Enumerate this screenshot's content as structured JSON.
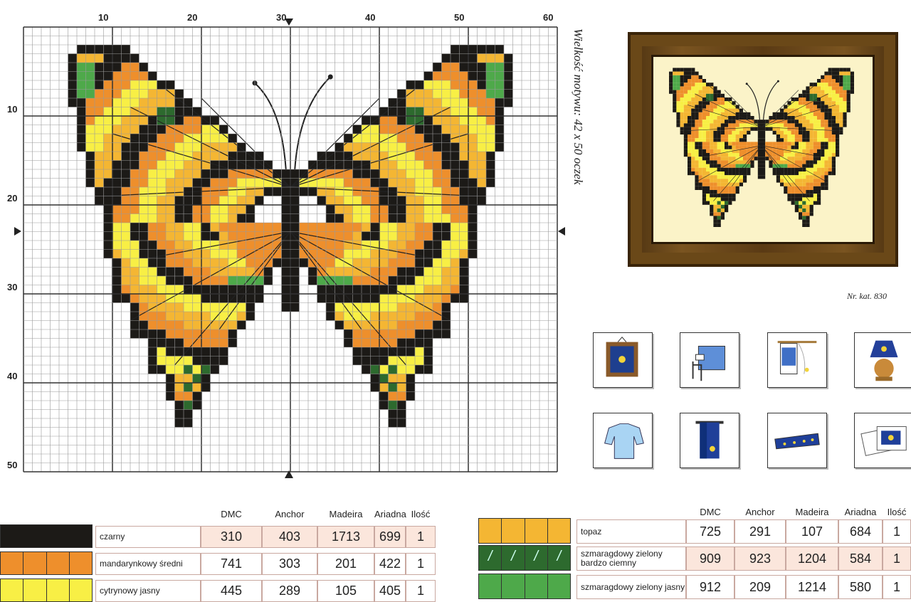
{
  "chart": {
    "col_labels": [
      "10",
      "20",
      "30",
      "40",
      "50",
      "60"
    ],
    "row_labels": [
      "10",
      "20",
      "30",
      "40",
      "50"
    ]
  },
  "size_note": "Wielkość motywu: 42 x 50 oczek",
  "catalog": "Nr. kat. 830",
  "colors": {
    "czarny": "#1c1a17",
    "mandarynkowy": "#ee8f2c",
    "cytrynowy": "#f8ef45",
    "topaz": "#f4b633",
    "green_dark": "#2d6a2e",
    "green_light": "#4ea94a"
  },
  "icons": [
    "framed-picture-icon",
    "bed-icon",
    "window-icon",
    "lamp-icon",
    "sweater-icon",
    "towel-icon",
    "ribbon-band-icon",
    "greeting-cards-icon"
  ],
  "legend": {
    "headers": [
      "DMC",
      "Anchor",
      "Madeira",
      "Ariadna",
      "Ilość"
    ],
    "left": [
      {
        "name": "czarny",
        "color": "#1c1a17",
        "symbol": "",
        "dmc": "310",
        "anchor": "403",
        "madeira": "1713",
        "ariadna": "699",
        "qty": "1"
      },
      {
        "name": "mandarynkowy średni",
        "color": "#ee8f2c",
        "symbol": "",
        "dmc": "741",
        "anchor": "303",
        "madeira": "201",
        "ariadna": "422",
        "qty": "1"
      },
      {
        "name": "cytrynowy jasny",
        "color": "#f8ef45",
        "symbol": "",
        "dmc": "445",
        "anchor": "289",
        "madeira": "105",
        "ariadna": "405",
        "qty": "1"
      }
    ],
    "right": [
      {
        "name": "topaz",
        "color": "#f4b633",
        "symbol": "",
        "dmc": "725",
        "anchor": "291",
        "madeira": "107",
        "ariadna": "684",
        "qty": "1"
      },
      {
        "name": "szmaragdowy zielony bardzo ciemny",
        "color": "#2d6a2e",
        "symbol": "/",
        "dmc": "909",
        "anchor": "923",
        "madeira": "1204",
        "ariadna": "584",
        "qty": "1"
      },
      {
        "name": "szmaragdowy zielony jasny",
        "color": "#4ea94a",
        "symbol": "",
        "dmc": "912",
        "anchor": "209",
        "madeira": "1214",
        "ariadna": "580",
        "qty": "1"
      }
    ]
  }
}
